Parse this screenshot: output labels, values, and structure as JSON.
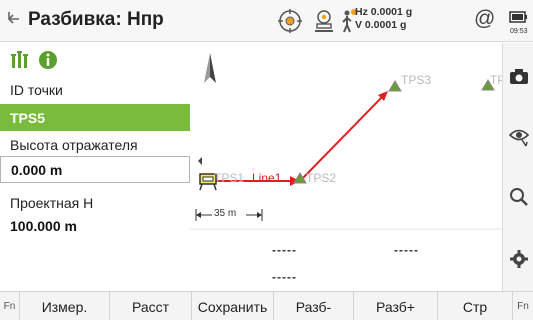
{
  "header": {
    "title": "Разбивка: Нпр",
    "hz": "Hz 0.0001 g",
    "v": "V  0.0001 g",
    "at_symbol": "@",
    "battery_time": "09:53"
  },
  "left_panel": {
    "point_id_label": "ID точки",
    "point_id_value": "TPS5",
    "reflector_height_label": "Высота отражателя",
    "reflector_height_value": "0.000 m",
    "design_h_label": "Проектная Н",
    "design_h_value": "100.000 m"
  },
  "map": {
    "points": [
      "TPS1",
      "TPS2",
      "TPS3",
      "TPF"
    ],
    "line_label": "Line1",
    "scale_label": "35 m",
    "readout_1": "-----",
    "readout_2": "-----",
    "readout_3": "-----"
  },
  "bottom_bar": {
    "fn_left": "Fn",
    "keys": [
      "Измер.",
      "Расст",
      "Сохранить",
      "Разб-",
      "Разб+",
      "Стр"
    ],
    "fn_right": "Fn"
  },
  "colors": {
    "accent_green": "#79bc3d",
    "route_red": "#e02020",
    "point_green": "#4a8a2a"
  },
  "icons": [
    "back-icon",
    "target-icon",
    "instrument-icon",
    "person-signal-icon",
    "battery-icon",
    "levels-icon",
    "info-icon",
    "north-arrow-icon",
    "camera-icon",
    "eye-icon",
    "search-icon",
    "settings-icon",
    "instrument-position-icon"
  ]
}
